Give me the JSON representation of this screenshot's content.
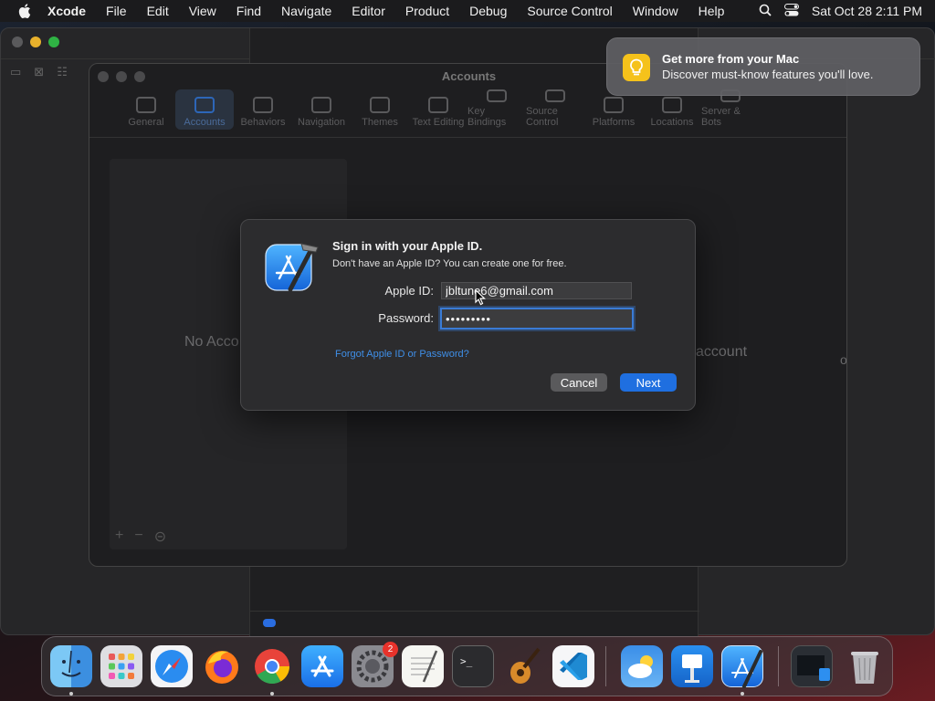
{
  "menubar": {
    "app_name": "Xcode",
    "items": [
      "File",
      "Edit",
      "View",
      "Find",
      "Navigate",
      "Editor",
      "Product",
      "Debug",
      "Source Control",
      "Window",
      "Help"
    ],
    "clock": "Sat Oct 28  2:11 PM"
  },
  "accounts_window": {
    "title": "Accounts",
    "tabs": [
      "General",
      "Accounts",
      "Behaviors",
      "Navigation",
      "Themes",
      "Text Editing",
      "Key Bindings",
      "Source Control",
      "Platforms",
      "Locations",
      "Server & Bots"
    ],
    "selected_tab": "Accounts",
    "list_empty_text": "No Acco",
    "main_text_1": "account",
    "main_text_2": "on"
  },
  "dialog": {
    "title": "Sign in with your Apple ID.",
    "subtitle": "Don't have an Apple ID? You can create one for free.",
    "apple_id_label": "Apple ID:",
    "apple_id_value": "jbltune6@gmail.com",
    "password_label": "Password:",
    "password_value": "•••••••••",
    "forgot_link": "Forgot Apple ID or Password?",
    "cancel_label": "Cancel",
    "next_label": "Next"
  },
  "notification": {
    "title": "Get more from your Mac",
    "body": "Discover must-know features you'll love.",
    "icon": "lightbulb-icon"
  },
  "dock": {
    "apps": [
      "Finder",
      "Launchpad",
      "Safari",
      "Firefox",
      "Chrome",
      "App Store",
      "System Settings",
      "TextEdit",
      "Terminal",
      "GarageBand",
      "Visual Studio Code",
      "Weather",
      "Keynote",
      "Xcode",
      "Screen Sharing",
      "Trash"
    ],
    "settings_badge": "2"
  },
  "colors": {
    "accent": "#1f6fe0",
    "link": "#3f8fe8",
    "menubar_bg": "#1b1b1d",
    "dialog_bg": "#2c2c2e",
    "notification_icon": "#f5c21b"
  }
}
